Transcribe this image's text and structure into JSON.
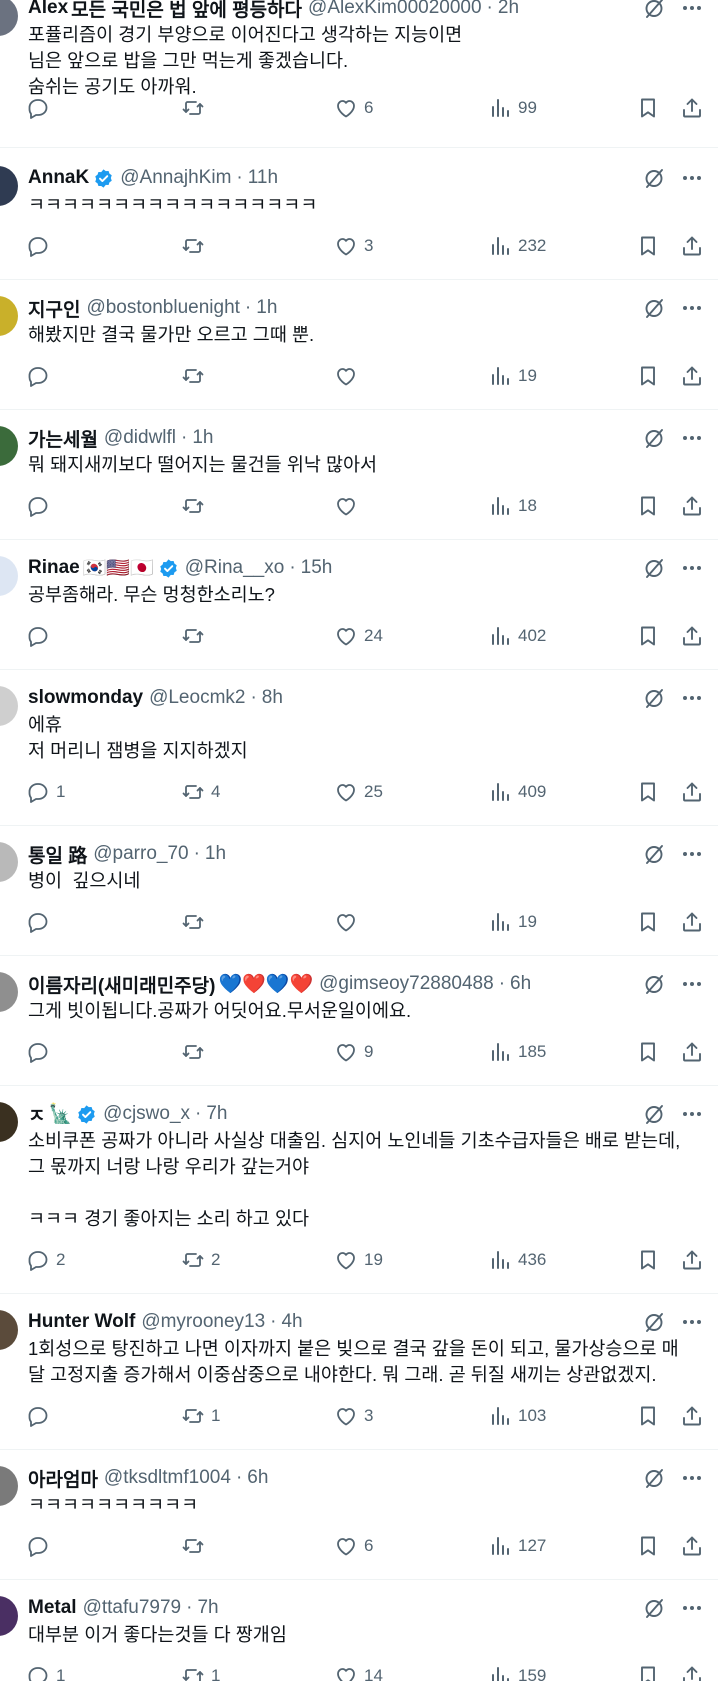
{
  "colors": {
    "text": "#0f1419",
    "secondary": "#536471",
    "divider": "#eff3f4",
    "verified": "#1d9bf0"
  },
  "icons": {
    "reply": "reply-icon",
    "retweet": "retweet-icon",
    "like": "like-icon",
    "views": "views-icon",
    "bookmark": "bookmark-icon",
    "share": "share-icon",
    "grok": "grok-icon",
    "more": "more-icon",
    "verified": "verified-badge-icon"
  },
  "tweets": [
    {
      "name": "Alex",
      "name_extra": "모든 국민은 법 앞에 평등하다",
      "handle": "@AlexKim00020000",
      "time": "2h",
      "text": "포퓰리즘이 경기 부양으로 이어진다고 생각하는 지능이면\n님은 앞으로 밥을 그만 먹는게 좋겠습니다.\n숨쉬는 공기도 아까워.",
      "replies": "",
      "retweets": "",
      "likes": "6",
      "views": "99"
    },
    {
      "name": "AnnaK",
      "handle": "@AnnajhKim",
      "time": "11h",
      "verified": true,
      "text": "ㅋㅋㅋㅋㅋㅋㅋㅋㅋㅋㅋㅋㅋㅋㅋㅋㅋ",
      "replies": "",
      "retweets": "",
      "likes": "3",
      "views": "232"
    },
    {
      "name": "지구인",
      "handle": "@bostonbluenight",
      "time": "1h",
      "text": "해봤지만 결국 물가만 오르고 그때 뿐.",
      "replies": "",
      "retweets": "",
      "likes": "",
      "views": "19"
    },
    {
      "name": "가는세월",
      "handle": "@didwlfl",
      "time": "1h",
      "text": "뭐 돼지새끼보다 떨어지는 물건들 위낙 많아서",
      "replies": "",
      "retweets": "",
      "likes": "",
      "views": "18"
    },
    {
      "name": "Rinae",
      "name_emoji": "🇰🇷🇺🇸🇯🇵",
      "handle": "@Rina__xo",
      "time": "15h",
      "verified": true,
      "text": "공부좀해라. 무슨 멍청한소리노?",
      "replies": "",
      "retweets": "",
      "likes": "24",
      "views": "402"
    },
    {
      "name": "slowmonday",
      "handle": "@Leocmk2",
      "time": "8h",
      "text": "에휴\n저 머리니 잼병을 지지하겠지",
      "replies": "1",
      "retweets": "4",
      "likes": "25",
      "views": "409"
    },
    {
      "name": "통일 路",
      "handle": "@parro_70",
      "time": "1h",
      "text": "병이  깊으시네",
      "replies": "",
      "retweets": "",
      "likes": "",
      "views": "19"
    },
    {
      "name": "이름자리(새미래민주당)",
      "name_emoji": "💙❤️💙❤️",
      "handle": "@gimseoy72880488",
      "time": "6h",
      "text": "그게 빗이됩니다.공짜가 어딧어요.무서운일이에요.",
      "replies": "",
      "retweets": "",
      "likes": "9",
      "views": "185"
    },
    {
      "name": "ㅈ",
      "name_emoji": "🗽",
      "handle": "@cjswo_x",
      "time": "7h",
      "verified": true,
      "text": "소비쿠폰 공짜가 아니라 사실상 대출임. 심지어 노인네들 기초수급자들은 배로 받는데, 그 몫까지 너랑 나랑 우리가 갚는거야\n\nㅋㅋㅋ 경기 좋아지는 소리 하고 있다",
      "replies": "2",
      "retweets": "2",
      "likes": "19",
      "views": "436"
    },
    {
      "name": "Hunter Wolf",
      "handle": "@myrooney13",
      "time": "4h",
      "text": "1회성으로 탕진하고 나면 이자까지 붙은 빚으로 결국 갚을 돈이 되고, 물가상승으로 매달 고정지출 증가해서 이중삼중으로 내야한다. 뭐 그래. 곧 뒤질 새끼는 상관없겠지.",
      "replies": "",
      "retweets": "1",
      "likes": "3",
      "views": "103"
    },
    {
      "name": "아라엄마",
      "handle": "@tksdltmf1004",
      "time": "6h",
      "text": "ㅋㅋㅋㅋㅋㅋㅋㅋㅋㅋ",
      "replies": "",
      "retweets": "",
      "likes": "6",
      "views": "127"
    },
    {
      "name": "Metal",
      "handle": "@ttafu7979",
      "time": "7h",
      "text": "대부분 이거 좋다는것들 다 짱개임",
      "replies": "1",
      "retweets": "1",
      "likes": "14",
      "views": "159"
    }
  ]
}
